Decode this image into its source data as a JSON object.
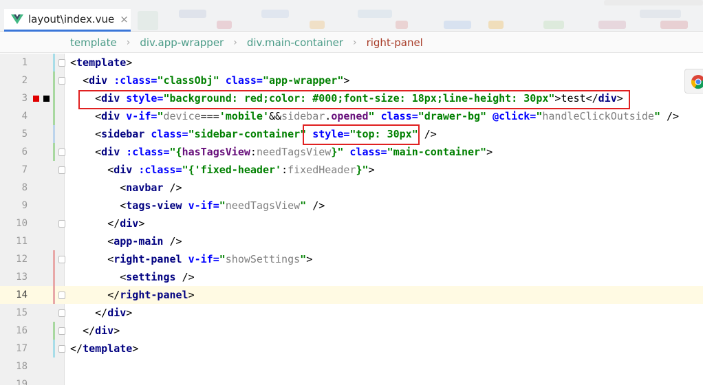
{
  "tab": {
    "title": "layout\\index.vue",
    "close_glyph": "×",
    "accent": "#3a76d8"
  },
  "breadcrumb": {
    "items": [
      "template",
      "div.app-wrapper",
      "div.main-container",
      "right-panel"
    ],
    "separator": "›"
  },
  "editor": {
    "current_line": 14,
    "lines": [
      {
        "n": "1",
        "parts": [
          [
            "punc",
            "<"
          ],
          [
            "tag",
            "template"
          ],
          [
            "punc",
            ">"
          ]
        ]
      },
      {
        "n": "2",
        "parts": [
          [
            "plain",
            "  "
          ],
          [
            "punc",
            "<"
          ],
          [
            "tag",
            "div "
          ],
          [
            "attr",
            ":class="
          ],
          [
            "str",
            "\""
          ],
          [
            "str",
            "classObj"
          ],
          [
            "str",
            "\" "
          ],
          [
            "attr",
            "class="
          ],
          [
            "str",
            "\"app-wrapper\""
          ],
          [
            "punc",
            ">"
          ]
        ]
      },
      {
        "n": "3",
        "parts": [
          [
            "plain",
            "    "
          ],
          [
            "punc",
            "<"
          ],
          [
            "tag",
            "div "
          ],
          [
            "attr",
            "style="
          ],
          [
            "str",
            "\"background: red;color: #000;font-size: 18px;line-height: 30px\""
          ],
          [
            "punc",
            ">test</"
          ],
          [
            "tag",
            "div"
          ],
          [
            "punc",
            ">"
          ]
        ]
      },
      {
        "n": "4",
        "parts": [
          [
            "plain",
            "    "
          ],
          [
            "punc",
            "<"
          ],
          [
            "tag",
            "div "
          ],
          [
            "attr",
            "v-if="
          ],
          [
            "str",
            "\""
          ],
          [
            "gray",
            "device"
          ],
          [
            "punc",
            "==="
          ],
          [
            "str",
            "'mobile'"
          ],
          [
            "punc",
            "&&"
          ],
          [
            "gray",
            "sidebar"
          ],
          [
            "punc",
            "."
          ],
          [
            "var",
            "opened"
          ],
          [
            "str",
            "\" "
          ],
          [
            "attr",
            "class="
          ],
          [
            "str",
            "\"drawer-bg\" "
          ],
          [
            "attr",
            "@click="
          ],
          [
            "str",
            "\""
          ],
          [
            "gray",
            "handleClickOutside"
          ],
          [
            "str",
            "\""
          ],
          [
            "punc",
            " />"
          ]
        ]
      },
      {
        "n": "5",
        "parts": [
          [
            "plain",
            "    "
          ],
          [
            "punc",
            "<"
          ],
          [
            "tag",
            "sidebar "
          ],
          [
            "attr",
            "class="
          ],
          [
            "str",
            "\"sidebar-container\" "
          ],
          [
            "attr",
            "style="
          ],
          [
            "str",
            "\"top: 30px\""
          ],
          [
            "punc",
            " />"
          ]
        ]
      },
      {
        "n": "6",
        "parts": [
          [
            "plain",
            "    "
          ],
          [
            "punc",
            "<"
          ],
          [
            "tag",
            "div "
          ],
          [
            "attr",
            ":class="
          ],
          [
            "str",
            "\"{"
          ],
          [
            "var",
            "hasTagsView"
          ],
          [
            "punc",
            ":"
          ],
          [
            "gray",
            "needTagsView"
          ],
          [
            "str",
            "}\" "
          ],
          [
            "attr",
            "class="
          ],
          [
            "str",
            "\"main-container\""
          ],
          [
            "punc",
            ">"
          ]
        ]
      },
      {
        "n": "7",
        "parts": [
          [
            "plain",
            "      "
          ],
          [
            "punc",
            "<"
          ],
          [
            "tag",
            "div "
          ],
          [
            "attr",
            ":class="
          ],
          [
            "str",
            "\"{"
          ],
          [
            "str",
            "'fixed-header'"
          ],
          [
            "punc",
            ":"
          ],
          [
            "gray",
            "fixedHeader"
          ],
          [
            "str",
            "}\""
          ],
          [
            "punc",
            ">"
          ]
        ]
      },
      {
        "n": "8",
        "parts": [
          [
            "plain",
            "        "
          ],
          [
            "punc",
            "<"
          ],
          [
            "tag",
            "navbar "
          ],
          [
            "punc",
            "/>"
          ]
        ]
      },
      {
        "n": "9",
        "parts": [
          [
            "plain",
            "        "
          ],
          [
            "punc",
            "<"
          ],
          [
            "tag",
            "tags-view "
          ],
          [
            "attr",
            "v-if="
          ],
          [
            "str",
            "\""
          ],
          [
            "gray",
            "needTagsView"
          ],
          [
            "str",
            "\" "
          ],
          [
            "punc",
            "/>"
          ]
        ]
      },
      {
        "n": "10",
        "parts": [
          [
            "plain",
            "      "
          ],
          [
            "punc",
            "</"
          ],
          [
            "tag",
            "div"
          ],
          [
            "punc",
            ">"
          ]
        ]
      },
      {
        "n": "11",
        "parts": [
          [
            "plain",
            "      "
          ],
          [
            "punc",
            "<"
          ],
          [
            "tag",
            "app-main "
          ],
          [
            "punc",
            "/>"
          ]
        ]
      },
      {
        "n": "12",
        "parts": [
          [
            "plain",
            "      "
          ],
          [
            "punc",
            "<"
          ],
          [
            "tag",
            "right-panel "
          ],
          [
            "attr",
            "v-if="
          ],
          [
            "str",
            "\""
          ],
          [
            "gray",
            "showSettings"
          ],
          [
            "str",
            "\""
          ],
          [
            "punc",
            ">"
          ]
        ]
      },
      {
        "n": "13",
        "parts": [
          [
            "plain",
            "        "
          ],
          [
            "punc",
            "<"
          ],
          [
            "tag",
            "settings "
          ],
          [
            "punc",
            "/>"
          ]
        ]
      },
      {
        "n": "14",
        "parts": [
          [
            "plain",
            "      "
          ],
          [
            "punc",
            "</"
          ],
          [
            "tag",
            "right-panel"
          ],
          [
            "punc",
            ">"
          ]
        ]
      },
      {
        "n": "15",
        "parts": [
          [
            "plain",
            "    "
          ],
          [
            "punc",
            "</"
          ],
          [
            "tag",
            "div"
          ],
          [
            "punc",
            ">"
          ]
        ]
      },
      {
        "n": "16",
        "parts": [
          [
            "plain",
            "  "
          ],
          [
            "punc",
            "</"
          ],
          [
            "tag",
            "div"
          ],
          [
            "punc",
            ">"
          ]
        ]
      },
      {
        "n": "17",
        "parts": [
          [
            "punc",
            "</"
          ],
          [
            "tag",
            "template"
          ],
          [
            "punc",
            ">"
          ]
        ]
      },
      {
        "n": "18",
        "parts": []
      },
      {
        "n": "19",
        "parts": []
      }
    ]
  },
  "colors": {
    "highlight_box": "#e02020",
    "current_line_bg": "#fffae3",
    "change_green": "#a8d8a0",
    "change_blue": "#bcd4ec",
    "change_red": "#e8a8a8"
  },
  "icons": {
    "vue": "vue-logo-icon",
    "chrome": "chrome-browser-icon",
    "breakpoint": "error-marker-icon"
  }
}
